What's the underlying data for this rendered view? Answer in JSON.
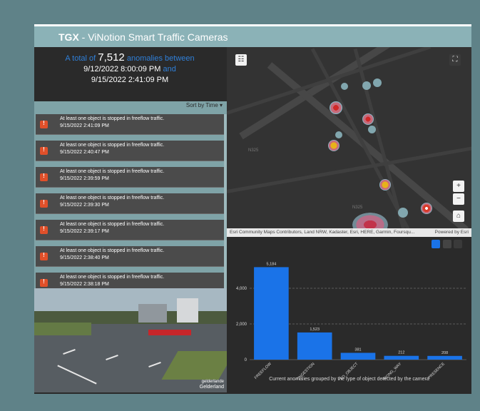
{
  "header": {
    "brand": "TGX",
    "title": " - ViNotion Smart Traffic Cameras"
  },
  "summary": {
    "prefix": "A total of",
    "count": "7,512",
    "middle": "anomalies between",
    "start": "9/12/2022 8:00:09 PM",
    "and": "and",
    "end": "9/15/2022 2:41:09 PM"
  },
  "list": {
    "sort_label": "Sort by Time ▾",
    "items": [
      {
        "message": "At least one object is stopped in freeflow traffic.",
        "time": "9/15/2022 2:41:09 PM"
      },
      {
        "message": "At least one object is stopped in freeflow traffic.",
        "time": "9/15/2022 2:40:47 PM"
      },
      {
        "message": "At least one object is stopped in freeflow traffic.",
        "time": "9/15/2022 2:39:59 PM"
      },
      {
        "message": "At least one object is stopped in freeflow traffic.",
        "time": "9/15/2022 2:39:30 PM"
      },
      {
        "message": "At least one object is stopped in freeflow traffic.",
        "time": "9/15/2022 2:39:17 PM"
      },
      {
        "message": "At least one object is stopped in freeflow traffic.",
        "time": "9/15/2022 2:38:40 PM"
      },
      {
        "message": "At least one object is stopped in freeflow traffic.",
        "time": "9/15/2022 2:38:18 PM"
      }
    ]
  },
  "video": {
    "watermark": "gelderlande",
    "region": "Gelderland"
  },
  "map": {
    "attribution": "Esri Community Maps Contributors, Land NRW, Kadaster, Esri, HERE, Garmin, Foursqu...",
    "powered": "Powered by Esri",
    "zoom_in": "+",
    "zoom_out": "−",
    "label_a": "N325",
    "label_b": "N325"
  },
  "chart_data": {
    "type": "bar",
    "categories": [
      "STOPPED_FREEFLOW",
      "STOPPED_CONGESTION",
      "PROHIBITED_OBJECT",
      "WRONG_WAY",
      "ZONE_PRESENCE"
    ],
    "values": [
      5184,
      1523,
      381,
      212,
      208
    ],
    "value_labels": [
      "5,184",
      "1,523",
      "381",
      "212",
      "208"
    ],
    "ylim": [
      0,
      6000
    ],
    "yticks": [
      0,
      2000,
      4000
    ],
    "ytick_labels": [
      "0",
      "2,000",
      "4,000"
    ],
    "caption": "Current anomalies grouped by the type of object detected by the camera",
    "bar_color": "#1a73e8",
    "grid": "dashed horizontal"
  },
  "colors": {
    "accent": "#2f7fd8",
    "background": "#5f8288",
    "header": "#8bb2b7",
    "warning": "#e0502a"
  }
}
